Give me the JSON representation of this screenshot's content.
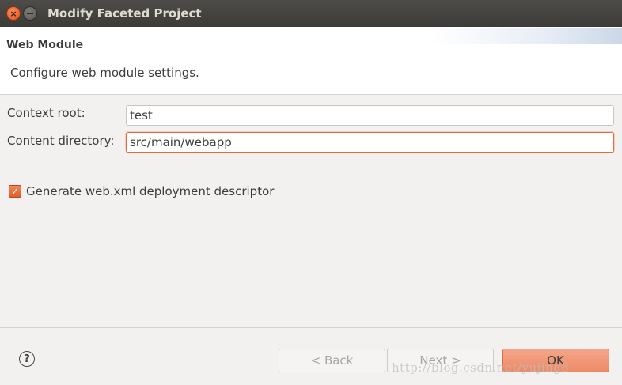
{
  "window": {
    "title": "Modify Faceted Project",
    "close_glyph": "×"
  },
  "header": {
    "title": "Web Module",
    "description": "Configure web module settings."
  },
  "form": {
    "context_root_label": "Context root:",
    "context_root_value": "test",
    "content_directory_label": "Content directory:",
    "content_directory_value": "src/main/webapp",
    "generate_descriptor_label": "Generate web.xml deployment descriptor",
    "generate_descriptor_checked": true,
    "check_glyph": "✓"
  },
  "footer": {
    "help_glyph": "?",
    "back_label": "< Back",
    "next_label": "Next >",
    "ok_label": "OK"
  },
  "watermark": "http://blog.csdn.net/yujing8",
  "colors": {
    "accent": "#e9541a",
    "ok_button": "#ee8b67",
    "titlebar": "#3c3b37"
  }
}
